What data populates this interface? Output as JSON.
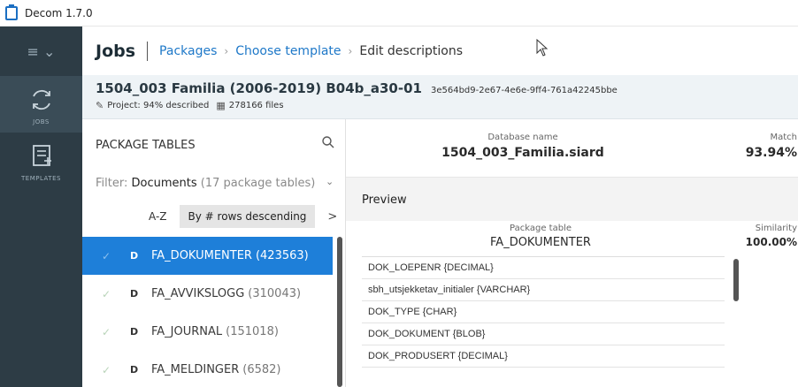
{
  "window": {
    "title": "Decom 1.7.0"
  },
  "rail": {
    "menu_label": "≡ ⌄",
    "items": [
      {
        "label": "JOBS",
        "icon": "sync-icon",
        "active": true
      },
      {
        "label": "TEMPLATES",
        "icon": "add-template-icon",
        "active": false
      }
    ]
  },
  "header": {
    "title": "Jobs",
    "breadcrumbs": [
      "Packages",
      "Choose template",
      "Edit descriptions"
    ]
  },
  "project": {
    "title": "1504_003 Familia (2006-2019) B04b_a30-01",
    "uuid": "3e564bd9-2e67-4e6e-9ff4-761a42245bbe",
    "described": "Project: 94% described",
    "files": "278166 files"
  },
  "package_tables": {
    "heading": "PACKAGE TABLES",
    "filter_label": "Filter:",
    "filter_value": "Documents",
    "filter_count": "(17 package tables)",
    "sort_az": "A-Z",
    "sort_active": "By # rows descending",
    "sort_next": ">",
    "rows": [
      {
        "type": "D",
        "name": "FA_DOKUMENTER",
        "count": "(423563)",
        "selected": true
      },
      {
        "type": "D",
        "name": "FA_AVVIKSLOGG",
        "count": "(310043)",
        "selected": false
      },
      {
        "type": "D",
        "name": "FA_JOURNAL",
        "count": "(151018)",
        "selected": false
      },
      {
        "type": "D",
        "name": "FA_MELDINGER",
        "count": "(6582)",
        "selected": false
      }
    ]
  },
  "detail": {
    "db_caption": "Database name",
    "db_name": "1504_003_Familia.siard",
    "match_caption": "Match",
    "match_value": "93.94%",
    "preview_label": "Preview",
    "pkg_caption": "Package table",
    "pkg_name": "FA_DOKUMENTER",
    "sim_caption": "Similarity",
    "sim_value": "100.00%",
    "columns": [
      "DOK_LOEPENR {DECIMAL}",
      "sbh_utsjekketav_initialer {VARCHAR}",
      "DOK_TYPE {CHAR}",
      "DOK_DOKUMENT {BLOB}",
      "DOK_PRODUSERT {DECIMAL}"
    ]
  }
}
